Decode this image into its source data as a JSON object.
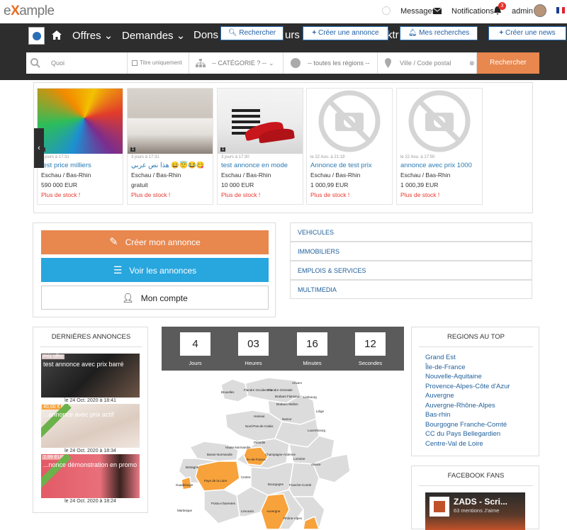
{
  "header": {
    "logo_e": "e",
    "logo_x": "X",
    "logo_rest": "ample",
    "messages": "Messages",
    "notifications": "Notifications",
    "notif_count": "3",
    "user": "admin"
  },
  "nav": {
    "items": [
      "Offres",
      "Demandes",
      "Dons",
      "urs",
      "ktr"
    ],
    "search_btn": "Rechercher",
    "create_ad_btn": "Créer une annonce",
    "my_searches_btn": "Mes recherches",
    "create_news_btn": "Créer une news"
  },
  "search": {
    "what_placeholder": "Quoi",
    "title_only": "Titre uniquement",
    "category": "-- CATÉGORIE ? --",
    "regions": "-- toutes les régions --",
    "city_placeholder": "Ville / Code postal",
    "submit": "Rechercher"
  },
  "listings": [
    {
      "meta": "3 jours à 17:31",
      "title": "test price milliers",
      "loc": "Eschau / Bas-Rhin",
      "price": "590 000 EUR",
      "stock": "Plus de stock !",
      "photos": "1"
    },
    {
      "meta": "3 jours à 17:31",
      "title": "هذا نص عربي 😄😇😂😋",
      "loc": "Eschau / Bas-Rhin",
      "price": "gratuit",
      "stock": "Plus de stock !",
      "photos": "1"
    },
    {
      "meta": "3 jours à 17:30",
      "title": "test annonce en mode",
      "loc": "Eschau / Bas-Rhin",
      "price": "10 000 EUR",
      "stock": "Plus de stock !",
      "photos": "1"
    },
    {
      "meta": "le 22 Aou. à 21:19",
      "title": "Annonce de test prix",
      "loc": "Eschau / Bas-Rhin",
      "price": "1 000,99 EUR",
      "stock": "Plus de stock !"
    },
    {
      "meta": "le 22 Aou. à 17:50",
      "title": "annonce avec prix 1000",
      "loc": "Eschau / Bas-Rhin",
      "price": "1 000,39 EUR",
      "stock": "Plus de stock !"
    }
  ],
  "actions": {
    "create": "Créer mon annonce",
    "view": "Voir les annonces",
    "account": "Mon compte"
  },
  "categories": [
    "VEHICULES",
    "IMMOBILIERS",
    "EMPLOIS & SERVICES",
    "MULTIMEDIA"
  ],
  "latest": {
    "title": "DERNIÈRES ANNONCES",
    "items": [
      {
        "tag": "Prix offre",
        "title": "test annonce avec prix barré",
        "date": "le 24 Oct. 2020 à 18:41"
      },
      {
        "tag": "40,00 €",
        "title": "...annonce avec prix actif",
        "date": "le 24 Oct. 2020 à 18:34"
      },
      {
        "tag": "2,99 EUR",
        "title": "...nonce démonstration en promo",
        "date": "le 24 Oct. 2020 à 18:24"
      }
    ]
  },
  "countdown": [
    {
      "value": "4",
      "label": "Jours"
    },
    {
      "value": "03",
      "label": "Heures"
    },
    {
      "value": "16",
      "label": "Minutes"
    },
    {
      "value": "12",
      "label": "Secondes"
    }
  ],
  "map_labels": [
    "Bruxelles",
    "Flandre Occidentale",
    "Flandre Orientale",
    "Anvers",
    "Brabant Flamand",
    "Brabant Wallon",
    "Limbourg",
    "Hainaut",
    "Namur",
    "Liège",
    "Nord-Pas-de-Calais",
    "Luxembourg",
    "Picardie",
    "Haute-Normandie",
    "Basse-Normandie",
    "Champagne-Ardenne",
    "Lorraine",
    "Ile-de-France",
    "Alsace",
    "Bretagne",
    "Pays de la Loire",
    "Centre",
    "Bourgogne",
    "Franche-Comté",
    "Guadeloupe",
    "Poitou-charentes",
    "Limousin",
    "Auvergne",
    "Rhône-Alpes",
    "Martinique"
  ],
  "top_regions": {
    "title": "REGIONS AU TOP",
    "items": [
      "Grand Est",
      "Île-de-France",
      "Nouvelle-Aquitaine",
      "Provence-Alpes-Côte d'Azur",
      "Auvergne",
      "Auvergne-Rhône-Alpes",
      "Bas-rhin",
      "Bourgogne Franche-Comté",
      "CC du Pays Bellegardien",
      "Centre-Val de Loire"
    ]
  },
  "facebook": {
    "title": "FACEBOOK FANS",
    "page": "ZADS - Scri...",
    "likes": "63 mentions J'aime"
  },
  "colors": {
    "accent": "#e8874e",
    "blue": "#28a6de",
    "dark": "#2d2d2d",
    "map_highlight": "#f7a23a"
  }
}
